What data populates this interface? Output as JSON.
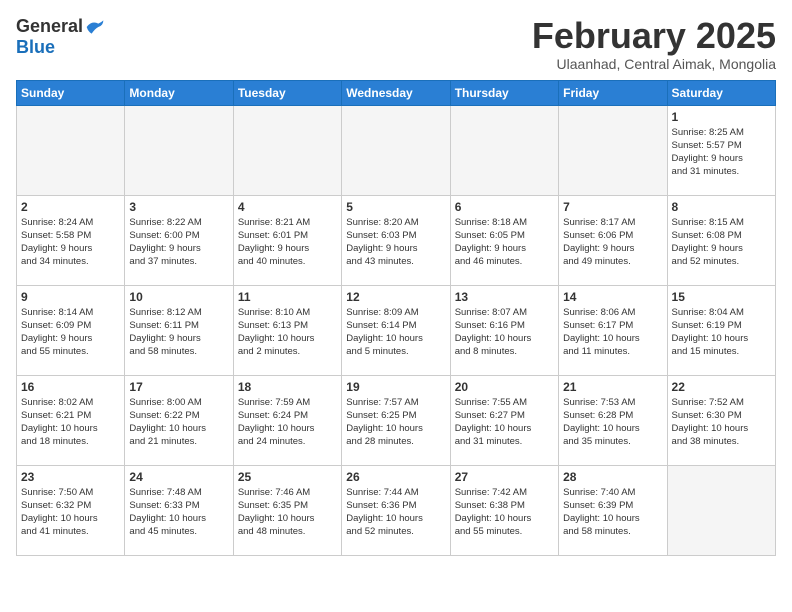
{
  "logo": {
    "general": "General",
    "blue": "Blue"
  },
  "title": "February 2025",
  "subtitle": "Ulaanhad, Central Aimak, Mongolia",
  "days_of_week": [
    "Sunday",
    "Monday",
    "Tuesday",
    "Wednesday",
    "Thursday",
    "Friday",
    "Saturday"
  ],
  "weeks": [
    [
      {
        "day": "",
        "info": ""
      },
      {
        "day": "",
        "info": ""
      },
      {
        "day": "",
        "info": ""
      },
      {
        "day": "",
        "info": ""
      },
      {
        "day": "",
        "info": ""
      },
      {
        "day": "",
        "info": ""
      },
      {
        "day": "1",
        "info": "Sunrise: 8:25 AM\nSunset: 5:57 PM\nDaylight: 9 hours\nand 31 minutes."
      }
    ],
    [
      {
        "day": "2",
        "info": "Sunrise: 8:24 AM\nSunset: 5:58 PM\nDaylight: 9 hours\nand 34 minutes."
      },
      {
        "day": "3",
        "info": "Sunrise: 8:22 AM\nSunset: 6:00 PM\nDaylight: 9 hours\nand 37 minutes."
      },
      {
        "day": "4",
        "info": "Sunrise: 8:21 AM\nSunset: 6:01 PM\nDaylight: 9 hours\nand 40 minutes."
      },
      {
        "day": "5",
        "info": "Sunrise: 8:20 AM\nSunset: 6:03 PM\nDaylight: 9 hours\nand 43 minutes."
      },
      {
        "day": "6",
        "info": "Sunrise: 8:18 AM\nSunset: 6:05 PM\nDaylight: 9 hours\nand 46 minutes."
      },
      {
        "day": "7",
        "info": "Sunrise: 8:17 AM\nSunset: 6:06 PM\nDaylight: 9 hours\nand 49 minutes."
      },
      {
        "day": "8",
        "info": "Sunrise: 8:15 AM\nSunset: 6:08 PM\nDaylight: 9 hours\nand 52 minutes."
      }
    ],
    [
      {
        "day": "9",
        "info": "Sunrise: 8:14 AM\nSunset: 6:09 PM\nDaylight: 9 hours\nand 55 minutes."
      },
      {
        "day": "10",
        "info": "Sunrise: 8:12 AM\nSunset: 6:11 PM\nDaylight: 9 hours\nand 58 minutes."
      },
      {
        "day": "11",
        "info": "Sunrise: 8:10 AM\nSunset: 6:13 PM\nDaylight: 10 hours\nand 2 minutes."
      },
      {
        "day": "12",
        "info": "Sunrise: 8:09 AM\nSunset: 6:14 PM\nDaylight: 10 hours\nand 5 minutes."
      },
      {
        "day": "13",
        "info": "Sunrise: 8:07 AM\nSunset: 6:16 PM\nDaylight: 10 hours\nand 8 minutes."
      },
      {
        "day": "14",
        "info": "Sunrise: 8:06 AM\nSunset: 6:17 PM\nDaylight: 10 hours\nand 11 minutes."
      },
      {
        "day": "15",
        "info": "Sunrise: 8:04 AM\nSunset: 6:19 PM\nDaylight: 10 hours\nand 15 minutes."
      }
    ],
    [
      {
        "day": "16",
        "info": "Sunrise: 8:02 AM\nSunset: 6:21 PM\nDaylight: 10 hours\nand 18 minutes."
      },
      {
        "day": "17",
        "info": "Sunrise: 8:00 AM\nSunset: 6:22 PM\nDaylight: 10 hours\nand 21 minutes."
      },
      {
        "day": "18",
        "info": "Sunrise: 7:59 AM\nSunset: 6:24 PM\nDaylight: 10 hours\nand 24 minutes."
      },
      {
        "day": "19",
        "info": "Sunrise: 7:57 AM\nSunset: 6:25 PM\nDaylight: 10 hours\nand 28 minutes."
      },
      {
        "day": "20",
        "info": "Sunrise: 7:55 AM\nSunset: 6:27 PM\nDaylight: 10 hours\nand 31 minutes."
      },
      {
        "day": "21",
        "info": "Sunrise: 7:53 AM\nSunset: 6:28 PM\nDaylight: 10 hours\nand 35 minutes."
      },
      {
        "day": "22",
        "info": "Sunrise: 7:52 AM\nSunset: 6:30 PM\nDaylight: 10 hours\nand 38 minutes."
      }
    ],
    [
      {
        "day": "23",
        "info": "Sunrise: 7:50 AM\nSunset: 6:32 PM\nDaylight: 10 hours\nand 41 minutes."
      },
      {
        "day": "24",
        "info": "Sunrise: 7:48 AM\nSunset: 6:33 PM\nDaylight: 10 hours\nand 45 minutes."
      },
      {
        "day": "25",
        "info": "Sunrise: 7:46 AM\nSunset: 6:35 PM\nDaylight: 10 hours\nand 48 minutes."
      },
      {
        "day": "26",
        "info": "Sunrise: 7:44 AM\nSunset: 6:36 PM\nDaylight: 10 hours\nand 52 minutes."
      },
      {
        "day": "27",
        "info": "Sunrise: 7:42 AM\nSunset: 6:38 PM\nDaylight: 10 hours\nand 55 minutes."
      },
      {
        "day": "28",
        "info": "Sunrise: 7:40 AM\nSunset: 6:39 PM\nDaylight: 10 hours\nand 58 minutes."
      },
      {
        "day": "",
        "info": ""
      }
    ]
  ]
}
